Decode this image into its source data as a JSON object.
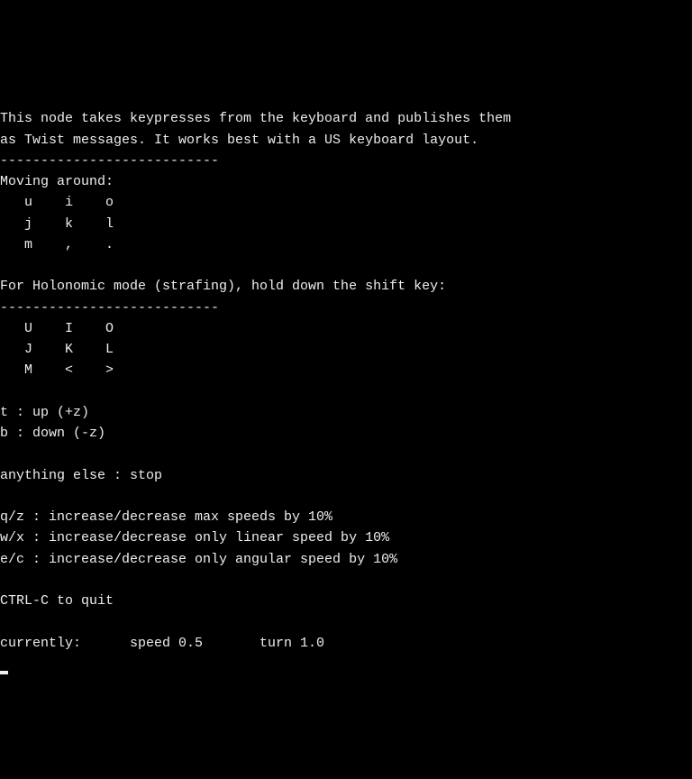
{
  "terminal": {
    "intro1": "This node takes keypresses from the keyboard and publishes them",
    "intro2": "as Twist messages. It works best with a US keyboard layout.",
    "divider": "---------------------------",
    "moving_header": "Moving around:",
    "moving_row1": "   u    i    o",
    "moving_row2": "   j    k    l",
    "moving_row3": "   m    ,    .",
    "holonomic_header": "For Holonomic mode (strafing), hold down the shift key:",
    "holonomic_row1": "   U    I    O",
    "holonomic_row2": "   J    K    L",
    "holonomic_row3": "   M    <    >",
    "t_key": "t : up (+z)",
    "b_key": "b : down (-z)",
    "stop": "anything else : stop",
    "qz": "q/z : increase/decrease max speeds by 10%",
    "wx": "w/x : increase/decrease only linear speed by 10%",
    "ec": "e/c : increase/decrease only angular speed by 10%",
    "quit": "CTRL-C to quit",
    "status": "currently:\tspeed 0.5\tturn 1.0 ",
    "status_values": {
      "speed": 0.5,
      "turn": 1.0
    }
  }
}
